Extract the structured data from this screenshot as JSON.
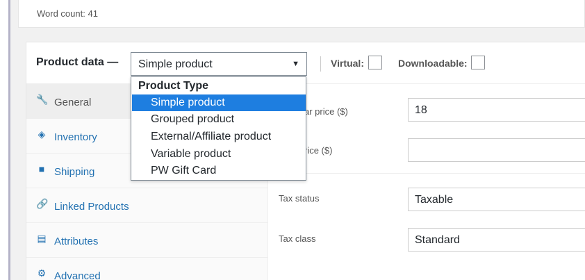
{
  "editor": {
    "word_count": "Word count: 41"
  },
  "product_data": {
    "label": "Product data —",
    "type_select": {
      "value": "Simple product",
      "arrow": "▼"
    },
    "virtual_label": "Virtual:",
    "downloadable_label": "Downloadable:"
  },
  "tabs": [
    {
      "label": "General",
      "icon": "wrench-icon",
      "glyph": "🔧"
    },
    {
      "label": "Inventory",
      "icon": "tag-icon",
      "glyph": "◈"
    },
    {
      "label": "Shipping",
      "icon": "truck-icon",
      "glyph": "■"
    },
    {
      "label": "Linked Products",
      "icon": "link-icon",
      "glyph": "🔗"
    },
    {
      "label": "Attributes",
      "icon": "list-icon",
      "glyph": "▤"
    },
    {
      "label": "Advanced",
      "icon": "gear-icon",
      "glyph": "⚙"
    }
  ],
  "general": {
    "regular_price_label": "ar price ($)",
    "regular_price_value": "18",
    "sale_price_label": "rice ($)",
    "sale_price_value": "",
    "tax_status_label": "Tax status",
    "tax_status_value": "Taxable",
    "tax_class_label": "Tax class",
    "tax_class_value": "Standard"
  },
  "dropdown": {
    "group_label": "Product Type",
    "options": [
      "Simple product",
      "Grouped product",
      "External/Affiliate product",
      "Variable product",
      "PW Gift Card"
    ],
    "selected_index": 0
  }
}
